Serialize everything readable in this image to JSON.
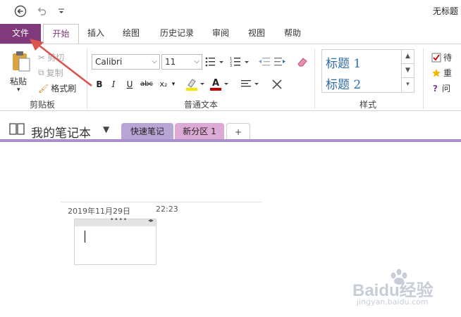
{
  "window": {
    "title": "无标题"
  },
  "ribbon_tabs": [
    "文件",
    "开始",
    "插入",
    "绘图",
    "历史记录",
    "审阅",
    "视图",
    "帮助"
  ],
  "clipboard": {
    "paste_label": "粘贴",
    "cut_label": "剪切",
    "copy_label": "复制",
    "format_painter_label": "格式刷",
    "group_label": "剪贴板"
  },
  "basic_text": {
    "font_name": "Calibri",
    "font_size": "11",
    "bold": "B",
    "italic": "I",
    "underline": "U",
    "strikethrough": "abc",
    "subscript": "x₂",
    "group_label": "普通文本"
  },
  "styles": {
    "items": [
      "标题 1",
      "标题 2"
    ],
    "group_label": "样式"
  },
  "tags": {
    "items": [
      "待",
      "重",
      "问"
    ]
  },
  "notebook": {
    "name": "我的笔记本",
    "sections": [
      "快速笔记",
      "新分区 1"
    ],
    "add_section_label": "+"
  },
  "page": {
    "date": "2019年11月29日",
    "time": "22:23"
  },
  "watermark": {
    "brand": "Baidu经验",
    "url": "jingyan.baidu.com"
  },
  "colors": {
    "file_tab": "#80397b",
    "section_quick": "#b8a5d6",
    "section_new": "#dcaad4",
    "accent_line": "#a98ec9",
    "annotation_arrow": "#d9534f"
  }
}
